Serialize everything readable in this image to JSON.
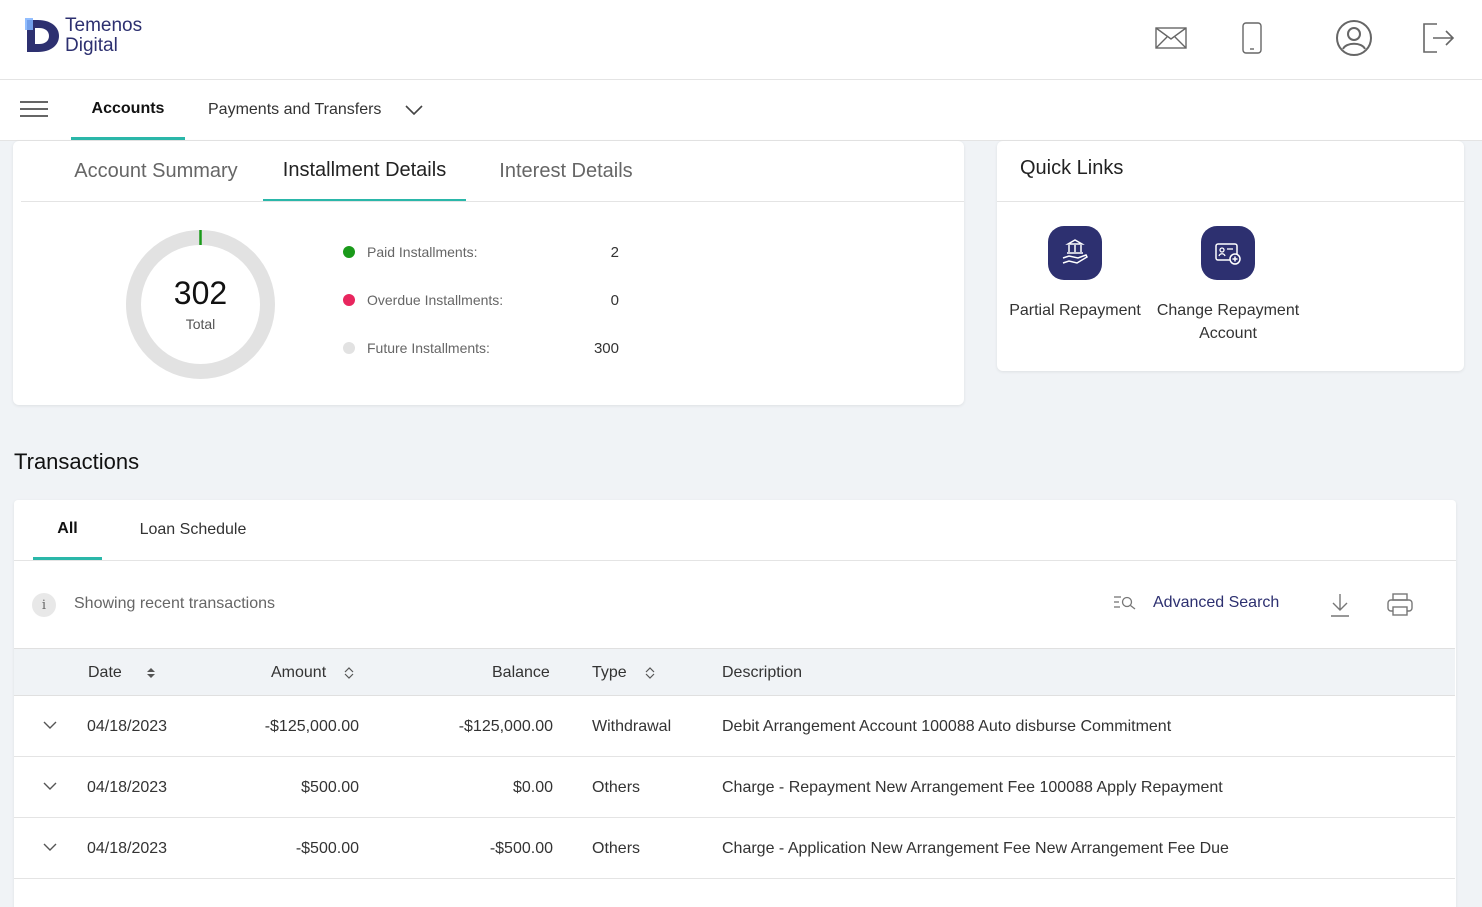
{
  "brand": {
    "line1": "Temenos",
    "line2": "Digital"
  },
  "nav": {
    "tabs": [
      {
        "label": "Accounts"
      },
      {
        "label": "Payments and Transfers"
      }
    ]
  },
  "summary": {
    "tabs": [
      {
        "label": "Account Summary"
      },
      {
        "label": "Installment Details"
      },
      {
        "label": "Interest Details"
      }
    ],
    "donut": {
      "total": "302",
      "total_label": "Total"
    },
    "legend": [
      {
        "label": "Paid Installments:",
        "value": "2",
        "color": "#1a9a1a"
      },
      {
        "label": "Overdue Installments:",
        "value": "0",
        "color": "#e8265e"
      },
      {
        "label": "Future Installments:",
        "value": "300",
        "color": "#e2e2e2"
      }
    ]
  },
  "quick_links": {
    "title": "Quick Links",
    "items": [
      {
        "label": "Partial Repayment"
      },
      {
        "label": "Change Repayment Account"
      }
    ]
  },
  "transactions": {
    "title": "Transactions",
    "tabs": [
      {
        "label": "All"
      },
      {
        "label": "Loan Schedule"
      }
    ],
    "info": "Showing recent transactions",
    "advanced_search": "Advanced Search",
    "columns": {
      "date": "Date",
      "amount": "Amount",
      "balance": "Balance",
      "type": "Type",
      "description": "Description"
    },
    "rows": [
      {
        "date": "04/18/2023",
        "amount": "-$125,000.00",
        "balance": "-$125,000.00",
        "type": "Withdrawal",
        "description": "Debit Arrangement Account 100088 Auto disburse Commitment"
      },
      {
        "date": "04/18/2023",
        "amount": "$500.00",
        "balance": "$0.00",
        "type": "Others",
        "description": "Charge - Repayment New Arrangement Fee 100088 Apply Repayment"
      },
      {
        "date": "04/18/2023",
        "amount": "-$500.00",
        "balance": "-$500.00",
        "type": "Others",
        "description": "Charge - Application New Arrangement Fee New Arrangement Fee Due"
      }
    ]
  },
  "colors": {
    "accent": "#2ab7a9",
    "brand": "#2d3070",
    "link": "#2d3070"
  },
  "icons": [
    "mail-icon",
    "mobile-icon",
    "user-profile-icon",
    "logout-icon",
    "hamburger-icon",
    "chevron-down-icon",
    "info-icon",
    "advanced-search-icon",
    "download-icon",
    "print-icon",
    "sort-icon"
  ]
}
